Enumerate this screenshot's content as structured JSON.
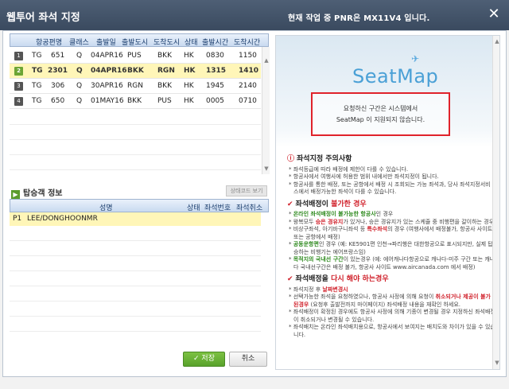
{
  "window": {
    "title": "웹투어 좌석 지정",
    "pnr_text": "현재 작업 중 PNR은 MX11V4 입니다.",
    "close_icon": "close-icon"
  },
  "flights": {
    "headers": [
      "항공편명",
      "클래스",
      "출발일",
      "출발도시",
      "도착도시",
      "상태",
      "출발시간",
      "도착시간"
    ],
    "rows": [
      {
        "no": "1",
        "airline": "TG",
        "flight": "651",
        "class": "Q",
        "date": "04APR16",
        "from": "PUS",
        "to": "BKK",
        "status": "HK",
        "dep": "0830",
        "arr": "1150",
        "selected": false
      },
      {
        "no": "2",
        "airline": "TG",
        "flight": "2301",
        "class": "Q",
        "date": "04APR16",
        "from": "BKK",
        "to": "RGN",
        "status": "HK",
        "dep": "1315",
        "arr": "1410",
        "selected": true
      },
      {
        "no": "3",
        "airline": "TG",
        "flight": "306",
        "class": "Q",
        "date": "30APR16",
        "from": "RGN",
        "to": "BKK",
        "status": "HK",
        "dep": "1945",
        "arr": "2140",
        "selected": false
      },
      {
        "no": "4",
        "airline": "TG",
        "flight": "650",
        "class": "Q",
        "date": "01MAY16",
        "from": "BKK",
        "to": "PUS",
        "status": "HK",
        "dep": "0005",
        "arr": "0710",
        "selected": false
      }
    ]
  },
  "passengers": {
    "section_title": "탑승객 정보",
    "status_code_button": "상태코드 보기",
    "headers": {
      "name": "성명",
      "status": "상태",
      "seat": "좌석번호",
      "cancel": "좌석취소"
    },
    "rows": [
      {
        "id": "P1",
        "name": "LEE/DONGHOONMR"
      }
    ]
  },
  "buttons": {
    "save": "✓ 저장",
    "cancel": "취소"
  },
  "seatmap": {
    "logo": "SeatMap",
    "notice_line1": "요청하신 구간은 시스템에서",
    "notice_line2": "SeatMap 이 지원되지 않습니다."
  },
  "info": {
    "caution_title": "좌석지정 주의사항",
    "caution_items": [
      "좌석등급에 따라 배정에 제한이 다를 수 있습니다.",
      "항공사에서 여행사에 허용한 범위 내에서만 좌석지정이 됩니다.",
      "항공사를 통한 배정, 또는 공항에서 배정 시 조회되는 가능 좌석과, 당사 좌석지정서비스에서 배정가능한 좌석이 다를 수 있습니다."
    ],
    "impossible_title_pre": "좌석배정이 ",
    "impossible_title_red": "불가한 경우",
    "impossible_items": [
      {
        "pre": "",
        "hl": "온라인 좌석배정이 불가능한 항공사",
        "post": "인 경우",
        "color": "g"
      },
      {
        "pre": "왕복모두 ",
        "hl": "승은 경유지",
        "post": "가 있거나, 승은 경유지가 있는 스케쥴 중 비행편을 갈이하는 경우",
        "color": "r"
      },
      {
        "pre": "비상구좌석, 아기바구니좌석 등 ",
        "hl": "특수좌석",
        "post": "의 경우 (여행사에서 배정불가, 항공사 사이트 또는 공항에서 배정)",
        "color": "r"
      },
      {
        "pre": "",
        "hl": "공동운항편",
        "post": "인 경우 (예: KE5901편 인천→파리행은 대한항공으로 표시되지만, 실제 탑승하는 비행기는 에어프랑스임)",
        "color": "g"
      },
      {
        "pre": "",
        "hl": "목적지의 국내선 구간",
        "post": "이 있는경우 (예: 에어캐나다항공으로 캐나다-미주 구간 또는 캐나다 국내선구간은 배정 불가, 항공사 사이트 www.aircanada.com 에서 배정)",
        "color": "g"
      }
    ],
    "redo_title_pre": "좌석배정을 ",
    "redo_title_red": "다시 해야 하는경우",
    "redo_items": [
      {
        "pre": "좌석지정 후 ",
        "hl": "날짜변경시",
        "post": "",
        "color": "r"
      },
      {
        "pre": "선택가능한 좌석을 요청하였으나, 항공사 사정에 의해 요청이 ",
        "hl": "취소되거나 제공이 불가된경우",
        "post": " (요청후 출발전까지 마이페이지) 좌석배정 내용을 재확인 하세요.",
        "color": "r"
      },
      {
        "pre": "좌석배정이 확정된 경우에도 항공사 사정에 의해 기종이 변경될 경우 지정하신 좌석배정이 취소되거나 변경될 수 있습니다.",
        "hl": "",
        "post": "",
        "color": "r"
      },
      {
        "pre": "좌석배치는 온라인 좌석배치용으로, 항공사에서 보여지는 배치도와 차이가 있을 수 있습니다.",
        "hl": "",
        "post": "",
        "color": "r"
      }
    ]
  },
  "colors": {
    "titlebar": "#3a4a5f",
    "selected_row": "#fff6b8",
    "accent_green": "#6ca534",
    "warning_red": "#d0202a",
    "seatmap_blue": "#4aa0d6"
  }
}
